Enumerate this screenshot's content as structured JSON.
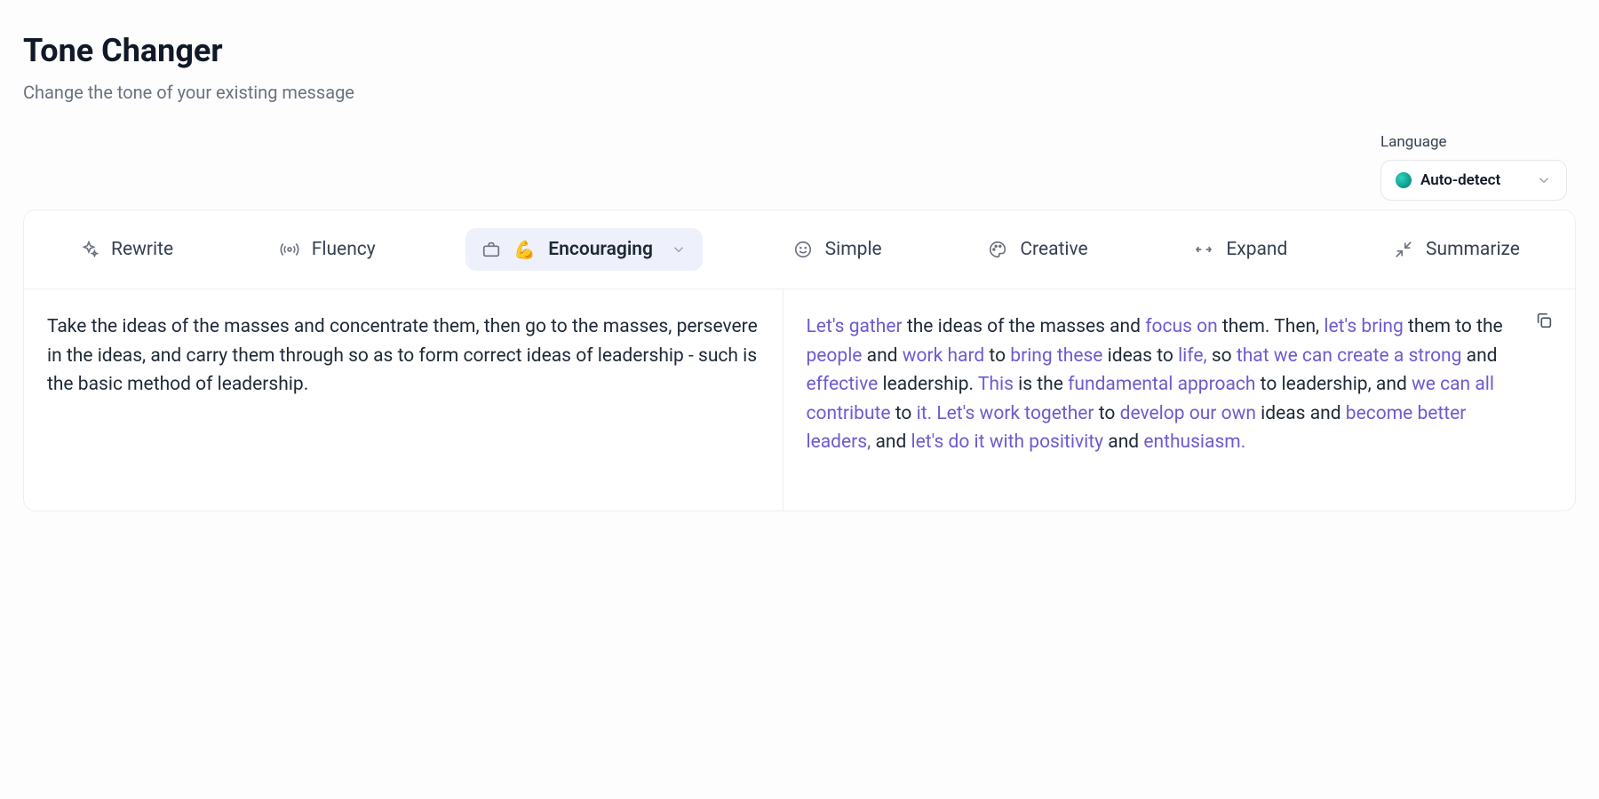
{
  "header": {
    "title": "Tone Changer",
    "subtitle": "Change the tone of your existing message"
  },
  "language": {
    "label": "Language",
    "value": "Auto-detect"
  },
  "tabs": {
    "rewrite": "Rewrite",
    "fluency": "Fluency",
    "encouraging": "Encouraging",
    "simple": "Simple",
    "creative": "Creative",
    "expand": "Expand",
    "summarize": "Summarize"
  },
  "input_text": "Take the ideas of the masses and concentrate them, then go to the masses, persevere in the ideas, and carry them through so as to form correct ideas of leadership - such is the basic method of leadership.",
  "output_segments": [
    {
      "t": "Let's gather",
      "h": true
    },
    {
      "t": " the ideas of the masses and ",
      "h": false
    },
    {
      "t": "focus on",
      "h": true
    },
    {
      "t": " them. Then, ",
      "h": false
    },
    {
      "t": "let's bring",
      "h": true
    },
    {
      "t": " them to the ",
      "h": false
    },
    {
      "t": "people",
      "h": true
    },
    {
      "t": " and ",
      "h": false
    },
    {
      "t": "work hard",
      "h": true
    },
    {
      "t": " to ",
      "h": false
    },
    {
      "t": "bring these",
      "h": true
    },
    {
      "t": " ideas to ",
      "h": false
    },
    {
      "t": "life,",
      "h": true
    },
    {
      "t": " so ",
      "h": false
    },
    {
      "t": "that we can create a strong",
      "h": true
    },
    {
      "t": " and ",
      "h": false
    },
    {
      "t": "effective",
      "h": true
    },
    {
      "t": " leadership. ",
      "h": false
    },
    {
      "t": "This",
      "h": true
    },
    {
      "t": " is the ",
      "h": false
    },
    {
      "t": "fundamental approach",
      "h": true
    },
    {
      "t": " to leadership, and ",
      "h": false
    },
    {
      "t": "we can all contribute",
      "h": true
    },
    {
      "t": " to ",
      "h": false
    },
    {
      "t": "it.",
      "h": true
    },
    {
      "t": " ",
      "h": false
    },
    {
      "t": "Let's work together",
      "h": true
    },
    {
      "t": " to ",
      "h": false
    },
    {
      "t": "develop our own",
      "h": true
    },
    {
      "t": " ideas and ",
      "h": false
    },
    {
      "t": "become better leaders,",
      "h": true
    },
    {
      "t": " and ",
      "h": false
    },
    {
      "t": "let's do it with positivity",
      "h": true
    },
    {
      "t": " and ",
      "h": false
    },
    {
      "t": "enthusiasm.",
      "h": true
    }
  ]
}
